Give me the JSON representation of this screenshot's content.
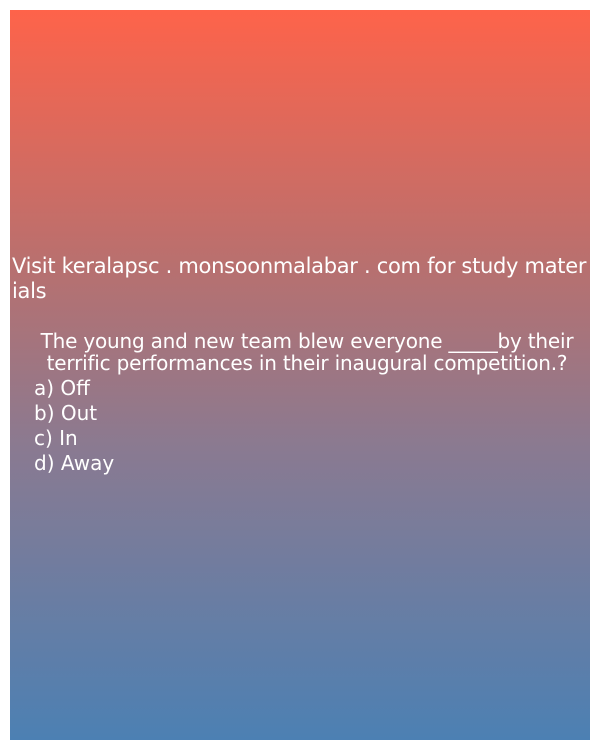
{
  "promo": {
    "text": "Visit keralapsc . monsoonmalabar . com for study materials"
  },
  "question": {
    "text": "The young and new team blew everyone _____by their terrific performances in their inaugural competition.?",
    "options": [
      "a) Off",
      "b) Out",
      "c) In",
      "d) Away"
    ]
  },
  "colors": {
    "gradient_top": "#fe634a",
    "gradient_bottom": "#4c80b3",
    "text": "#ffffff"
  }
}
